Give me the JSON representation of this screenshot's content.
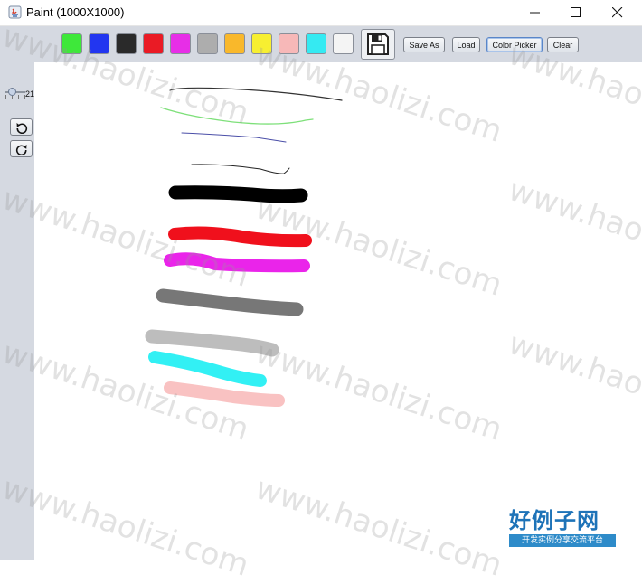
{
  "window": {
    "title": "Paint (1000X1000)"
  },
  "palette": {
    "colors": [
      {
        "name": "green",
        "hex": "#3ee83a"
      },
      {
        "name": "blue",
        "hex": "#2236f0"
      },
      {
        "name": "black",
        "hex": "#2a2a2a"
      },
      {
        "name": "red",
        "hex": "#ea1b25"
      },
      {
        "name": "magenta",
        "hex": "#e72ee7"
      },
      {
        "name": "gray",
        "hex": "#adadad"
      },
      {
        "name": "orange",
        "hex": "#f9b82b"
      },
      {
        "name": "yellow",
        "hex": "#f7ef31"
      },
      {
        "name": "pink",
        "hex": "#f7b8b8"
      },
      {
        "name": "cyan",
        "hex": "#35eaf2"
      },
      {
        "name": "white",
        "hex": "#f4f4f4"
      }
    ]
  },
  "toolbar": {
    "save_icon": "floppy-disk-icon",
    "save_as_label": "Save As",
    "load_label": "Load",
    "color_picker_label": "Color Picker",
    "clear_label": "Clear"
  },
  "side": {
    "stroke_size": "21",
    "undo_icon": "undo-icon",
    "redo_icon": "redo-icon"
  },
  "watermark": {
    "text": "www.haolizi.com",
    "logo_main": "好例子网",
    "logo_sub": "开发实例分享交流平台"
  }
}
